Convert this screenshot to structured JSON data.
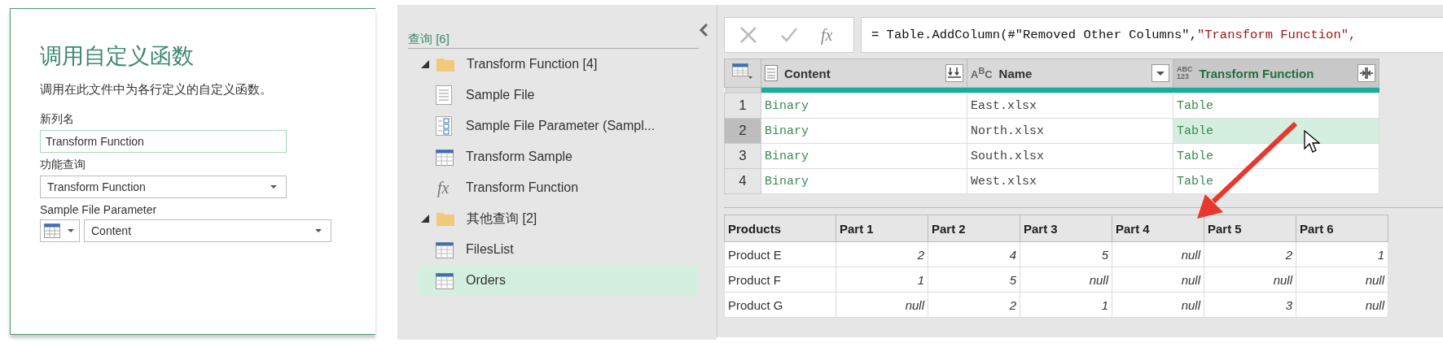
{
  "dialog": {
    "title": "调用自定义函数",
    "description": "调用在此文件中为各行定义的自定义函数。",
    "fields": [
      {
        "kind": "text",
        "label": "新列名",
        "value": "Transform Function"
      },
      {
        "kind": "dropdown",
        "label": "功能查询",
        "value": "Transform Function"
      },
      {
        "kind": "typed-dropdown",
        "label": "Sample File Parameter",
        "value": "Content"
      }
    ]
  },
  "queries": {
    "title": "查询 [6]",
    "groups": [
      {
        "name": "Transform Function [4]",
        "expanded": true,
        "children": [
          {
            "name": "Sample File",
            "kind": "document",
            "selected": false
          },
          {
            "name": "Sample File Parameter (Sampl...",
            "kind": "parameter",
            "selected": false
          },
          {
            "name": "Transform Sample",
            "kind": "table",
            "selected": false
          },
          {
            "name": "Transform Function",
            "kind": "function",
            "icon_text": "fx",
            "selected": false
          }
        ]
      },
      {
        "name": "其他查询 [2]",
        "expanded": true,
        "children": [
          {
            "name": "FilesList",
            "kind": "table",
            "selected": false
          },
          {
            "name": "Orders",
            "kind": "table",
            "selected": true
          }
        ]
      }
    ]
  },
  "formula_icon": "fx",
  "formula": [
    {
      "kind": "code",
      "text": "= Table.AddColumn(#\"Removed Other Columns\", "
    },
    {
      "kind": "string",
      "text": "\"Transform Function\","
    }
  ],
  "preview_table": {
    "columns": [
      {
        "name": "Content",
        "kind": "binary",
        "button": {
          "kind": "expand"
        },
        "selected": false
      },
      {
        "name": "Name",
        "kind": "text",
        "type_label": [
          "A$^{B}$C"
        ],
        "button": {
          "kind": "filter"
        },
        "selected": false
      },
      {
        "name": "Transform Function",
        "kind": "any",
        "type_label": [
          "ABC",
          "123"
        ],
        "button": {
          "kind": "expand-columns"
        },
        "selected": true
      }
    ],
    "rows": [
      {
        "number": "1",
        "cells": [
          "Binary",
          "East.xlsx",
          "Table"
        ],
        "selected": false
      },
      {
        "number": "2",
        "cells": [
          "Binary",
          "North.xlsx",
          "Table"
        ],
        "selected": true
      },
      {
        "number": "3",
        "cells": [
          "Binary",
          "South.xlsx",
          "Table"
        ],
        "selected": false
      },
      {
        "number": "4",
        "cells": [
          "Binary",
          "West.xlsx",
          "Table"
        ],
        "selected": false
      }
    ]
  },
  "result_table": {
    "columns": [
      "Products",
      "Part 1",
      "Part 2",
      "Part 3",
      "Part 4",
      "Part 5",
      "Part 6"
    ],
    "rows": [
      [
        "Product E",
        "2",
        "4",
        "5",
        "null",
        "2",
        "1"
      ],
      [
        "Product F",
        "1",
        "5",
        "null",
        "null",
        "null",
        "null"
      ],
      [
        "Product G",
        "null",
        "2",
        "1",
        "null",
        "3",
        "null"
      ]
    ]
  }
}
